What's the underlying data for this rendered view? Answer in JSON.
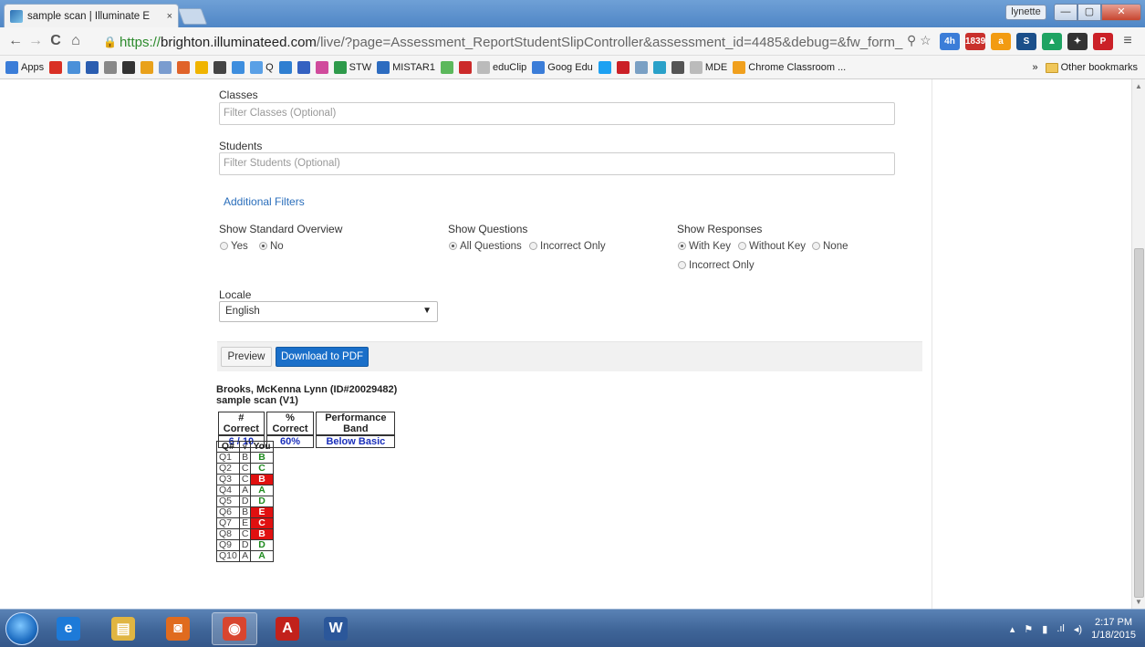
{
  "browser": {
    "tab_title": "sample scan | Illuminate E",
    "tab_close": "×",
    "user_label": "lynette",
    "window_controls": {
      "minimize": "—",
      "maximize": "▢",
      "close": "✕"
    },
    "url_https": "https://",
    "url_host": "brighton.illuminateed.com",
    "url_path": "/live/?page=Assessment_ReportStudentSlipController&assessment_id=4485&debug=&fw_form_",
    "nav": {
      "back": "←",
      "forward": "→",
      "reload": "C",
      "home": "⌂",
      "search": "⚲",
      "star": "☆",
      "menu": "≡"
    },
    "extensions": [
      {
        "name": "calendar-extension-icon",
        "label": "4h",
        "color": "#3b7dd8"
      },
      {
        "name": "gmail-extension-icon",
        "label": "1839",
        "color": "#c9302c"
      },
      {
        "name": "amazon-extension-icon",
        "label": "a",
        "color": "#f29b12"
      },
      {
        "name": "s-extension-icon",
        "label": "S",
        "color": "#1b4f8a"
      },
      {
        "name": "drive-extension-icon",
        "label": "▲",
        "color": "#1ea362"
      },
      {
        "name": "feedly-extension-icon",
        "label": "✦",
        "color": "#333333"
      },
      {
        "name": "pinterest-extension-icon",
        "label": "P",
        "color": "#cb2027"
      }
    ]
  },
  "bookmarks": {
    "items": [
      {
        "label": "Apps",
        "color": "#3b7dd8"
      },
      {
        "label": "",
        "color": "#d93025"
      },
      {
        "label": "",
        "color": "#4a90d9"
      },
      {
        "label": "",
        "color": "#2a5db0"
      },
      {
        "label": "",
        "color": "#888888"
      },
      {
        "label": "",
        "color": "#333333"
      },
      {
        "label": "",
        "color": "#e9a11b"
      },
      {
        "label": "",
        "color": "#7a9ccf"
      },
      {
        "label": "",
        "color": "#e0632a"
      },
      {
        "label": "",
        "color": "#f0b400"
      },
      {
        "label": "",
        "color": "#444444"
      },
      {
        "label": "",
        "color": "#3e8ede"
      },
      {
        "label": "Q",
        "color": "#5aa0e6"
      },
      {
        "label": "",
        "color": "#2f7fd1"
      },
      {
        "label": "",
        "color": "#3461c1"
      },
      {
        "label": "",
        "color": "#d04b9c"
      },
      {
        "label": "STW",
        "color": "#2e9a4b"
      },
      {
        "label": "MISTAR1",
        "color": "#2d6cc0"
      },
      {
        "label": "",
        "color": "#5cb85c"
      },
      {
        "label": "",
        "color": "#cc2b2b"
      },
      {
        "label": "eduClip",
        "color": "#bbbbbb"
      },
      {
        "label": "Goog Edu",
        "color": "#3b7dd8"
      },
      {
        "label": "",
        "color": "#1da1f2"
      },
      {
        "label": "",
        "color": "#cb2027"
      },
      {
        "label": "",
        "color": "#7aa0c4"
      },
      {
        "label": "",
        "color": "#2aa1c9"
      },
      {
        "label": "",
        "color": "#555555"
      },
      {
        "label": "MDE",
        "color": "#bbbbbb"
      },
      {
        "label": "Chrome Classroom ...",
        "color": "#f0a01e"
      }
    ],
    "overflow": "»",
    "other": "Other bookmarks"
  },
  "form": {
    "classes_label": "Classes",
    "classes_placeholder": "Filter Classes (Optional)",
    "students_label": "Students",
    "students_placeholder": "Filter Students (Optional)",
    "additional_filters": "Additional Filters",
    "standard_overview": {
      "label": "Show Standard Overview",
      "options": [
        "Yes",
        "No"
      ],
      "selected": "No"
    },
    "questions": {
      "label": "Show Questions",
      "options": [
        "All Questions",
        "Incorrect Only"
      ],
      "selected": "All Questions"
    },
    "responses": {
      "label": "Show Responses",
      "options": [
        "With Key",
        "Without Key",
        "None",
        "Incorrect Only"
      ],
      "selected": "With Key"
    },
    "locale_label": "Locale",
    "locale_value": "English",
    "preview_button": "Preview",
    "pdf_button": "Download to PDF"
  },
  "report": {
    "student": "Brooks, McKenna Lynn (ID#20029482)",
    "assessment": "sample scan (V1)",
    "summary_headers": [
      "# Correct",
      "% Correct",
      "Performance Band"
    ],
    "summary_values": [
      "6 / 10",
      "60%",
      "Below Basic"
    ],
    "question_headers": [
      "Q#",
      "√",
      "You"
    ],
    "questions": [
      {
        "q": "Q1",
        "key": "B",
        "you": "B",
        "correct": true
      },
      {
        "q": "Q2",
        "key": "C",
        "you": "C",
        "correct": true
      },
      {
        "q": "Q3",
        "key": "C",
        "you": "B",
        "correct": false
      },
      {
        "q": "Q4",
        "key": "A",
        "you": "A",
        "correct": true
      },
      {
        "q": "Q5",
        "key": "D",
        "you": "D",
        "correct": true
      },
      {
        "q": "Q6",
        "key": "B",
        "you": "E",
        "correct": false
      },
      {
        "q": "Q7",
        "key": "E",
        "you": "C",
        "correct": false
      },
      {
        "q": "Q8",
        "key": "C",
        "you": "B",
        "correct": false
      },
      {
        "q": "Q9",
        "key": "D",
        "you": "D",
        "correct": true
      },
      {
        "q": "Q10",
        "key": "A",
        "you": "A",
        "correct": true
      }
    ]
  },
  "taskbar": {
    "apps": [
      {
        "name": "ie-taskbar-icon",
        "glyph": "e",
        "color": "#1d7ad8",
        "active": false
      },
      {
        "name": "explorer-taskbar-icon",
        "glyph": "▤",
        "color": "#e0b542",
        "active": false
      },
      {
        "name": "media-taskbar-icon",
        "glyph": "◙",
        "color": "#e06b1e",
        "active": false
      },
      {
        "name": "chrome-taskbar-icon",
        "glyph": "◉",
        "color": "#d8452f",
        "active": true
      },
      {
        "name": "acrobat-taskbar-icon",
        "glyph": "A",
        "color": "#c2211b",
        "active": false
      },
      {
        "name": "word-taskbar-icon",
        "glyph": "W",
        "color": "#2b579a",
        "active": false
      }
    ],
    "time": "2:17 PM",
    "date": "1/18/2015"
  }
}
